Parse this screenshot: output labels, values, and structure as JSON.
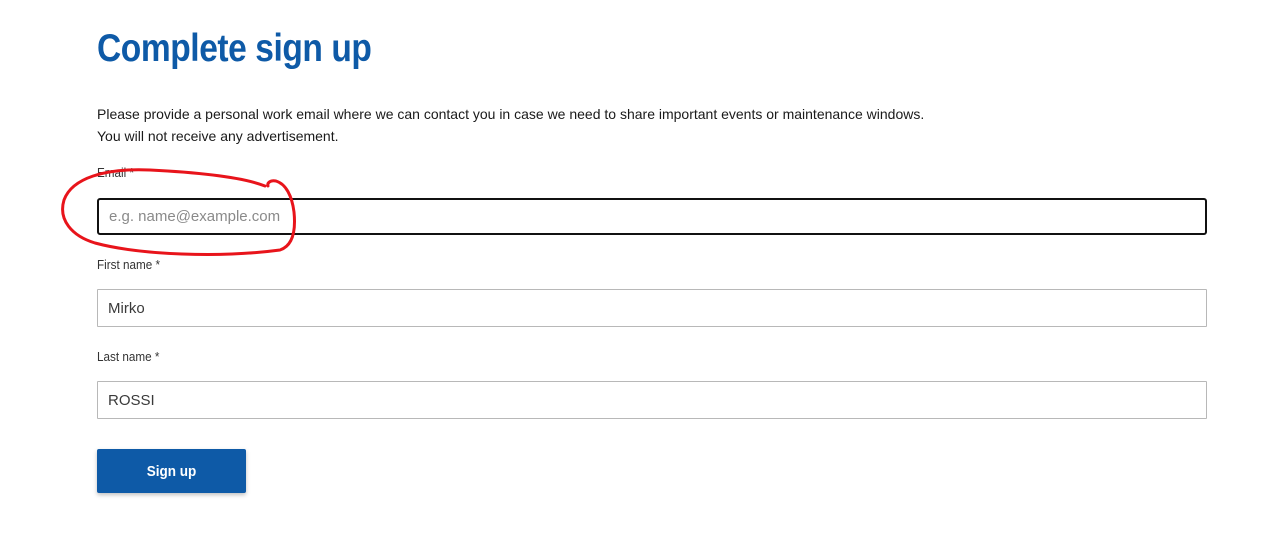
{
  "page": {
    "title": "Complete sign up",
    "intro_line1": "Please provide a personal work email where we can contact you in case we need to share important events or maintenance windows.",
    "intro_line2": "You will not receive any advertisement."
  },
  "form": {
    "email": {
      "label": "Email *",
      "value": "",
      "placeholder": "e.g. name@example.com"
    },
    "first_name": {
      "label": "First name *",
      "value": "Mirko"
    },
    "last_name": {
      "label": "Last name *",
      "value": "ROSSI"
    },
    "submit_label": "Sign up"
  },
  "colors": {
    "brand": "#0e5aa7",
    "annotation": "#e8141b"
  }
}
